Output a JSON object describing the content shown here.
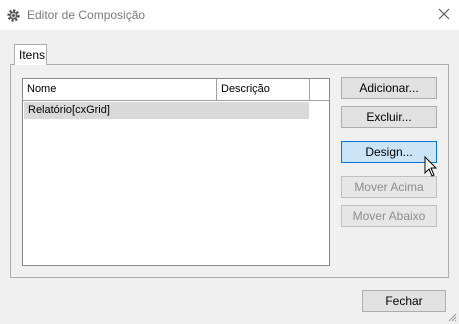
{
  "window": {
    "title": "Editor de Composição",
    "close_icon": "close-icon",
    "app_icon": "gear-icon"
  },
  "tabs": [
    {
      "label": "Itens",
      "selected": true
    }
  ],
  "list": {
    "columns": [
      "Nome",
      "Descrição"
    ],
    "rows": [
      {
        "name": "Relatório[cxGrid]",
        "description": ""
      }
    ]
  },
  "buttons": {
    "add": "Adicionar...",
    "delete": "Excluir...",
    "design": "Design...",
    "move_up": "Mover Acima",
    "move_down": "Mover Abaixo",
    "close": "Fechar"
  }
}
